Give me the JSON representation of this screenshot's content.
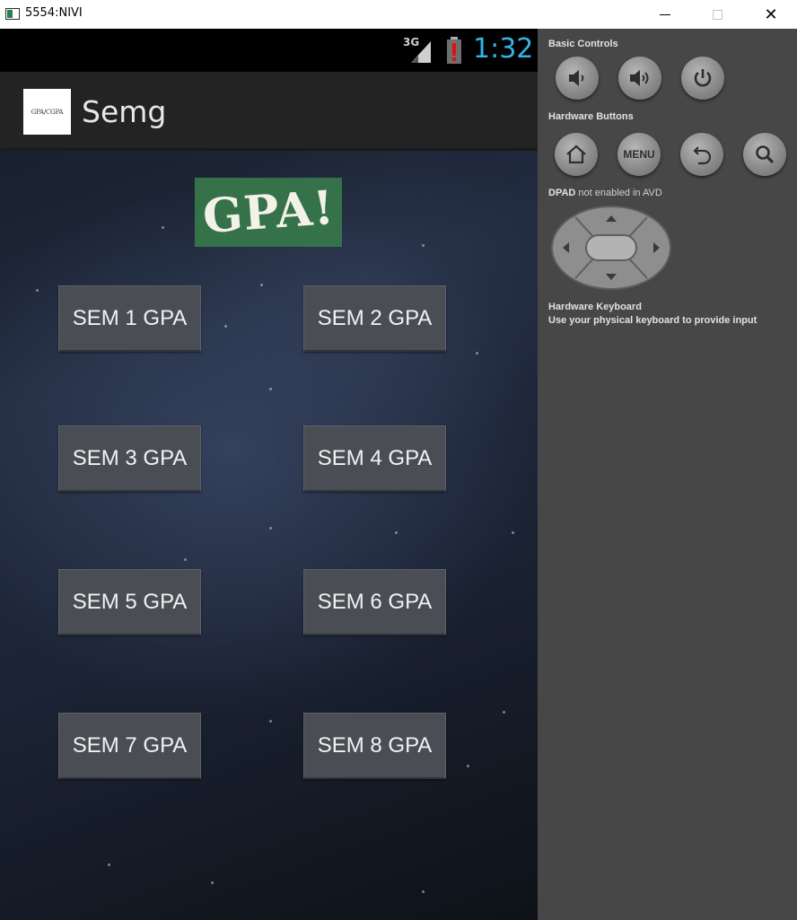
{
  "window": {
    "title": "5554:NIVI",
    "minimize_icon": "minimize-icon",
    "maximize_icon": "maximize-icon",
    "close_icon": "close-icon"
  },
  "statusbar": {
    "network": "3G",
    "time": "1:32",
    "time_color": "#33b5e5",
    "icons": [
      "signal-icon",
      "battery-alert-icon"
    ]
  },
  "actionbar": {
    "logo_text": "GPA/CGPA",
    "title": "Semg"
  },
  "banner": {
    "text": "GPA!",
    "background": "#35724a"
  },
  "buttons": [
    {
      "label": "SEM 1 GPA"
    },
    {
      "label": "SEM 2 GPA"
    },
    {
      "label": "SEM 3 GPA"
    },
    {
      "label": "SEM 4 GPA"
    },
    {
      "label": "SEM 5 GPA"
    },
    {
      "label": "SEM 6 GPA"
    },
    {
      "label": "SEM 7 GPA"
    },
    {
      "label": "SEM 8 GPA"
    }
  ],
  "panel": {
    "basic_controls_label": "Basic Controls",
    "basic_controls": [
      "volume-down-icon",
      "volume-up-icon",
      "power-icon"
    ],
    "hardware_buttons_label": "Hardware Buttons",
    "hardware_buttons": [
      "home-icon",
      "menu-button",
      "back-icon",
      "search-icon"
    ],
    "menu_label": "MENU",
    "dpad_label": "DPAD",
    "dpad_note": "not enabled in AVD",
    "keyboard_label": "Hardware Keyboard",
    "keyboard_note": "Use your physical keyboard to provide input"
  }
}
